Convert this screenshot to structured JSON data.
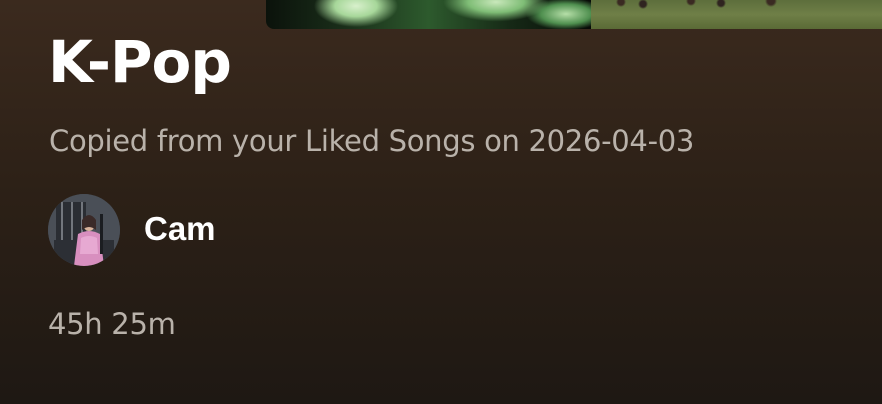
{
  "playlist": {
    "title": "K-Pop",
    "description": "Copied from your Liked Songs on 2026-04-03",
    "owner": {
      "name": "Cam",
      "avatar_icon": "user-avatar-photo"
    },
    "duration": "45h 25m"
  },
  "colors": {
    "background_top": "#3b2a1e",
    "background_bottom": "#1e1813",
    "title": "#ffffff",
    "secondary_text": "#b9b2aa"
  }
}
